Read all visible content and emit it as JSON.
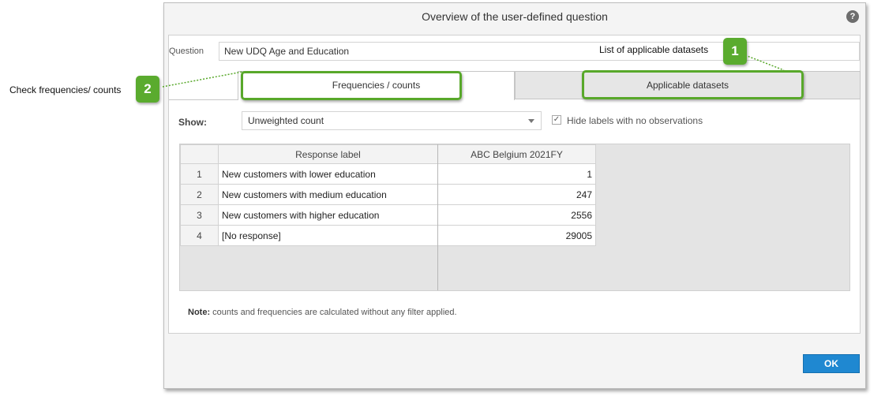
{
  "dialog": {
    "title": "Overview of the user-defined question",
    "help_icon": "?",
    "question_label": "Question",
    "question_value": "New UDQ Age and Education",
    "tabs": [
      {
        "label": "Frequencies / counts",
        "active": true
      },
      {
        "label": "Applicable datasets",
        "active": false
      }
    ],
    "show_label": "Show:",
    "show_value": "Unweighted count",
    "hide_labels_checked": "✓",
    "hide_labels_text": "Hide labels with no observations",
    "table": {
      "headers": [
        "Response label",
        "ABC Belgium 2021FY"
      ],
      "rows": [
        {
          "n": "1",
          "label": "New customers with lower education",
          "value": "1"
        },
        {
          "n": "2",
          "label": "New customers with medium education",
          "value": "247"
        },
        {
          "n": "3",
          "label": "New customers with higher education",
          "value": "2556"
        },
        {
          "n": "4",
          "label": "[No response]",
          "value": "29005"
        }
      ]
    },
    "note_bold": "Note:",
    "note_text": " counts and frequencies are calculated without any filter applied.",
    "ok_label": "OK"
  },
  "callouts": [
    {
      "number": "1",
      "text": "List of applicable datasets"
    },
    {
      "number": "2",
      "text": "Check frequencies/ counts"
    }
  ],
  "colors": {
    "accent_green": "#5aab2e",
    "ok_blue": "#1f88d1"
  }
}
